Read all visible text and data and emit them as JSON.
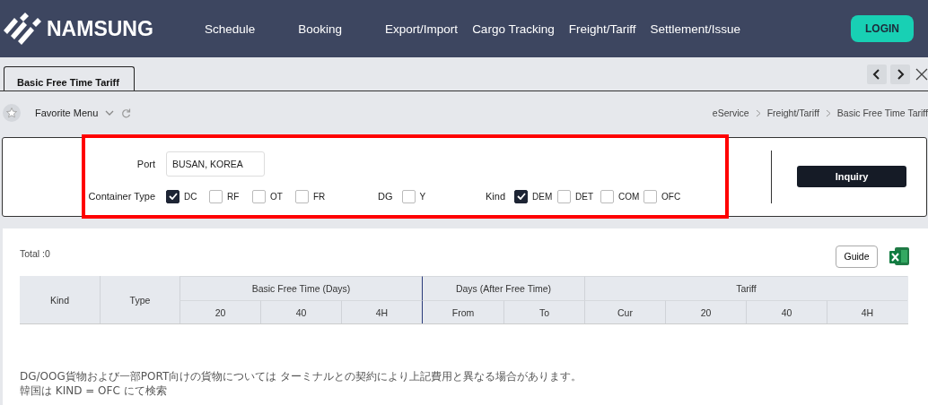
{
  "header": {
    "logo": "NAMSUNG",
    "nav": [
      "Schedule",
      "Booking",
      "Export/Import",
      "Cargo Tracking",
      "Freight/Tariff",
      "Settlement/Issue"
    ],
    "login": "LOGIN"
  },
  "tabs": [
    {
      "label": "Basic Free Time Tariff",
      "selected": true
    }
  ],
  "favorite_menu": "Favorite Menu",
  "breadcrumb": [
    "eService",
    "Freight/Tariff",
    "Basic Free Time Tariff"
  ],
  "search": {
    "port_label": "Port",
    "port_value": "BUSAN, KOREA",
    "container_type_label": "Container Type",
    "container_types": [
      {
        "label": "DC",
        "checked": true
      },
      {
        "label": "RF",
        "checked": false
      },
      {
        "label": "OT",
        "checked": false
      },
      {
        "label": "FR",
        "checked": false
      }
    ],
    "dg_label": "DG",
    "dg": [
      {
        "label": "Y",
        "checked": false
      }
    ],
    "kind_label": "Kind",
    "kinds": [
      {
        "label": "DEM",
        "checked": true
      },
      {
        "label": "DET",
        "checked": false
      },
      {
        "label": "COM",
        "checked": false
      },
      {
        "label": "OFC",
        "checked": false
      }
    ],
    "inquiry": "Inquiry"
  },
  "results": {
    "total": "Total :0",
    "guide": "Guide",
    "table": {
      "columns": [
        {
          "label": "Kind"
        },
        {
          "label": "Type"
        },
        {
          "label": "Basic Free Time (Days)",
          "sub": [
            "20",
            "40",
            "4H"
          ]
        },
        {
          "label": "Days (After Free Time)",
          "sub": [
            "From",
            "To"
          ]
        },
        {
          "label": "Tariff",
          "sub": [
            "Cur",
            "20",
            "40",
            "4H"
          ]
        }
      ]
    }
  },
  "notes": [
    "DG/OOG貨物および一部PORT向けの貨物については ターミナルとの契約により上記費用と異なる場合があります。",
    "韓国は KIND = OFC にて検索"
  ]
}
